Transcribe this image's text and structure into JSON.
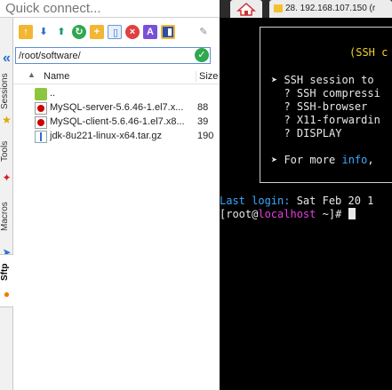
{
  "quick_connect": {
    "placeholder": "Quick connect..."
  },
  "side_tabs": [
    {
      "label": "Sessions",
      "icon": "star-icon"
    },
    {
      "label": "Tools",
      "icon": "wrench-icon"
    },
    {
      "label": "Macros",
      "icon": "paper-plane-icon"
    },
    {
      "label": "Sftp",
      "icon": "sftp-icon"
    }
  ],
  "sftp": {
    "toolbar": [
      "folder-up-icon",
      "download-icon",
      "upload-icon",
      "refresh-icon",
      "new-folder-icon",
      "new-file-icon",
      "delete-icon",
      "rename-icon",
      "text-edit-icon",
      "tools-icon"
    ],
    "path": "/root/software/",
    "columns": {
      "name": "Name",
      "size": "Size"
    },
    "files": [
      {
        "name": "..",
        "size": "",
        "type": "parent-folder"
      },
      {
        "name": "MySQL-server-5.6.46-1.el7.x...",
        "size": "88",
        "type": "rpm"
      },
      {
        "name": "MySQL-client-5.6.46-1.el7.x8...",
        "size": "39",
        "type": "rpm"
      },
      {
        "name": "jdk-8u221-linux-x64.tar.gz",
        "size": "190",
        "type": "archive"
      }
    ]
  },
  "tabs": {
    "session_label": "28. 192.168.107.150 (r"
  },
  "terminal": {
    "box_title": "(SSH c",
    "box_lines": [
      "➤ SSH session to",
      "  ? SSH compressi",
      "  ? SSH-browser",
      "  ? X11-forwardin",
      "  ? DISPLAY"
    ],
    "more_info_prefix": "➤ For more ",
    "more_info_word": "info",
    "more_info_suffix": ",",
    "last_login_label": "Last login:",
    "last_login_value": " Sat Feb 20 1",
    "prompt_open": "[root@",
    "prompt_host": "localhost",
    "prompt_close": " ~]# "
  },
  "colors": {
    "terminal_bg": "#000000",
    "terminal_fg": "#e8e8e8",
    "accent_yellow": "#f0d030",
    "accent_cyan": "#3aa8ff",
    "accent_magenta": "#e83ce0",
    "path_border": "#5b8fd6"
  }
}
